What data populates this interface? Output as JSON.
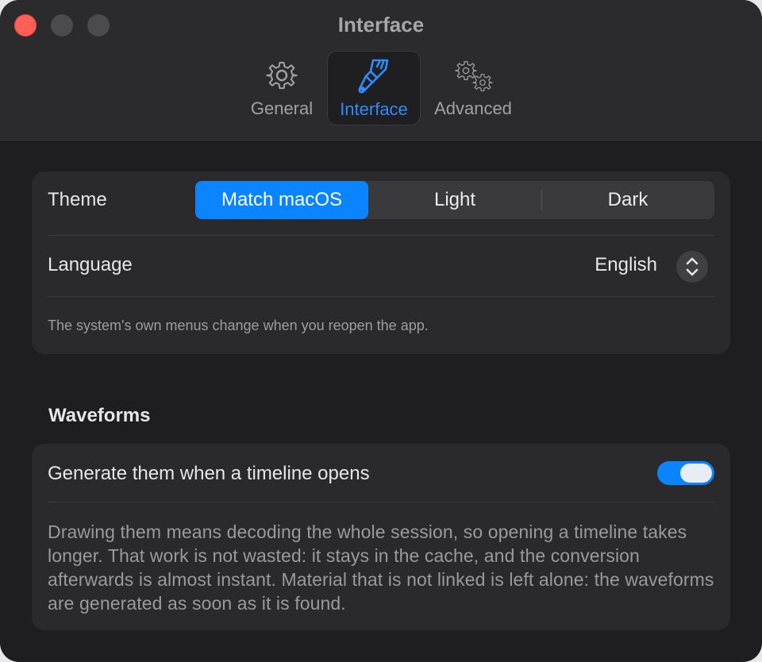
{
  "window": {
    "title": "Interface"
  },
  "toolbar": {
    "tabs": [
      {
        "label": "General",
        "icon": "gear-icon"
      },
      {
        "label": "Interface",
        "icon": "paintbrush-icon",
        "active": true
      },
      {
        "label": "Advanced",
        "icon": "gears-icon"
      }
    ]
  },
  "appearance": {
    "theme_label": "Theme",
    "theme_options": [
      "Match macOS",
      "Light",
      "Dark"
    ],
    "theme_selected": "Match macOS",
    "language_label": "Language",
    "language_value": "English",
    "language_note": "The system's own menus change when you reopen the app."
  },
  "waveforms": {
    "section_title": "Waveforms",
    "toggle_label": "Generate them when a timeline opens",
    "toggle_on": true,
    "description": "Drawing them means decoding the whole session, so opening a timeline takes longer. That work is not wasted: it stays in the cache, and the conversion afterwards is almost instant. Material that is not linked is left alone: the waveforms are generated as soon as it is found."
  },
  "colors": {
    "accent": "#0a84ff",
    "close": "#fe5f57",
    "background": "#1e1e20",
    "card": "#2a2a2c"
  }
}
